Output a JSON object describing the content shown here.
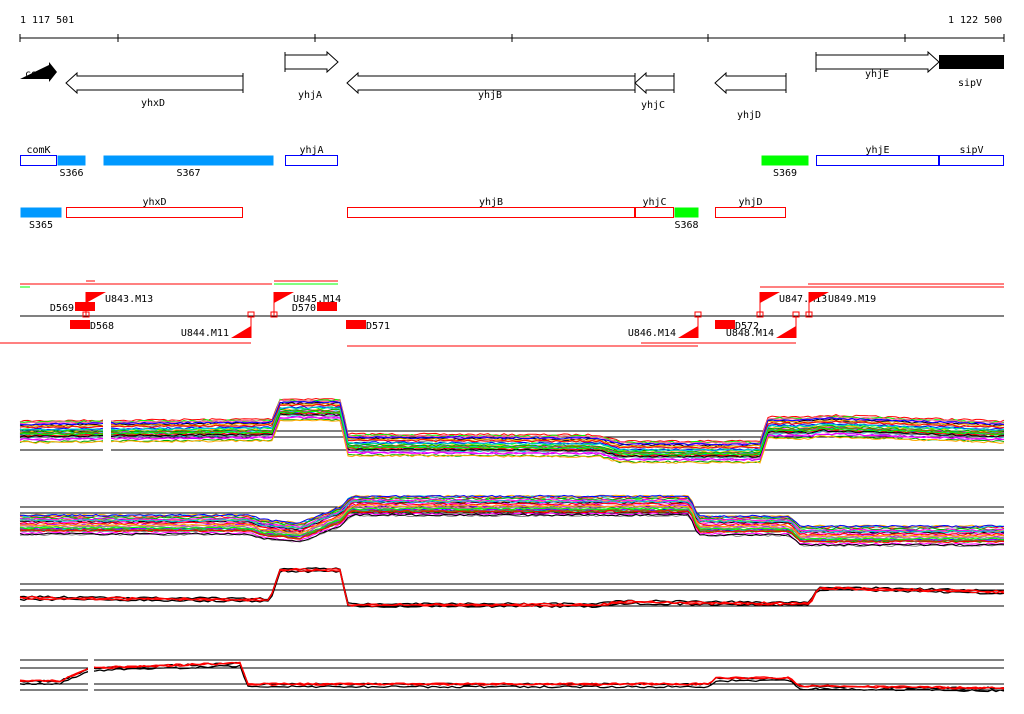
{
  "axis": {
    "start_label": "1 117 501",
    "end_label": "1 122 500",
    "start": 1117501,
    "end": 1122500
  },
  "genes": [
    {
      "name": "comK",
      "strand": "+",
      "style": "filled"
    },
    {
      "name": "yhxD",
      "strand": "-",
      "style": "outline"
    },
    {
      "name": "yhjA",
      "strand": "+",
      "style": "outline"
    },
    {
      "name": "yhjB",
      "strand": "-",
      "style": "outline"
    },
    {
      "name": "yhjC",
      "strand": "-",
      "style": "outline"
    },
    {
      "name": "yhjD",
      "strand": "-",
      "style": "outline"
    },
    {
      "name": "yhjE",
      "strand": "+",
      "style": "outline"
    },
    {
      "name": "sipV",
      "strand": "+",
      "style": "filled"
    }
  ],
  "forward_transcripts": [
    {
      "label": "comK",
      "kind": "gene"
    },
    {
      "label": "S366",
      "kind": "segment"
    },
    {
      "label": "S367",
      "kind": "segment"
    },
    {
      "label": "yhjA",
      "kind": "gene"
    },
    {
      "label": "S369",
      "kind": "segment"
    },
    {
      "label": "yhjE",
      "kind": "gene"
    },
    {
      "label": "sipV",
      "kind": "gene"
    }
  ],
  "reverse_transcripts": [
    {
      "label": "S365",
      "kind": "segment"
    },
    {
      "label": "yhxD",
      "kind": "gene"
    },
    {
      "label": "yhjB",
      "kind": "gene"
    },
    {
      "label": "yhjC",
      "kind": "gene"
    },
    {
      "label": "S368",
      "kind": "segment"
    },
    {
      "label": "yhjD",
      "kind": "gene"
    }
  ],
  "features": {
    "upshifts": [
      "U843.M13",
      "U845.M14",
      "U847.M13",
      "U849.M19"
    ],
    "downshifts": [
      "U844.M11",
      "U846.M14",
      "U848.M14"
    ],
    "breakpoints": [
      "D569",
      "D570",
      "D568",
      "D571",
      "D572"
    ]
  },
  "colors": {
    "segment_blue": "#0099ff",
    "segment_green": "#00ff00",
    "forward_outline": "#0000ff",
    "reverse_outline": "#ff0000",
    "feature": "#ff0000"
  }
}
